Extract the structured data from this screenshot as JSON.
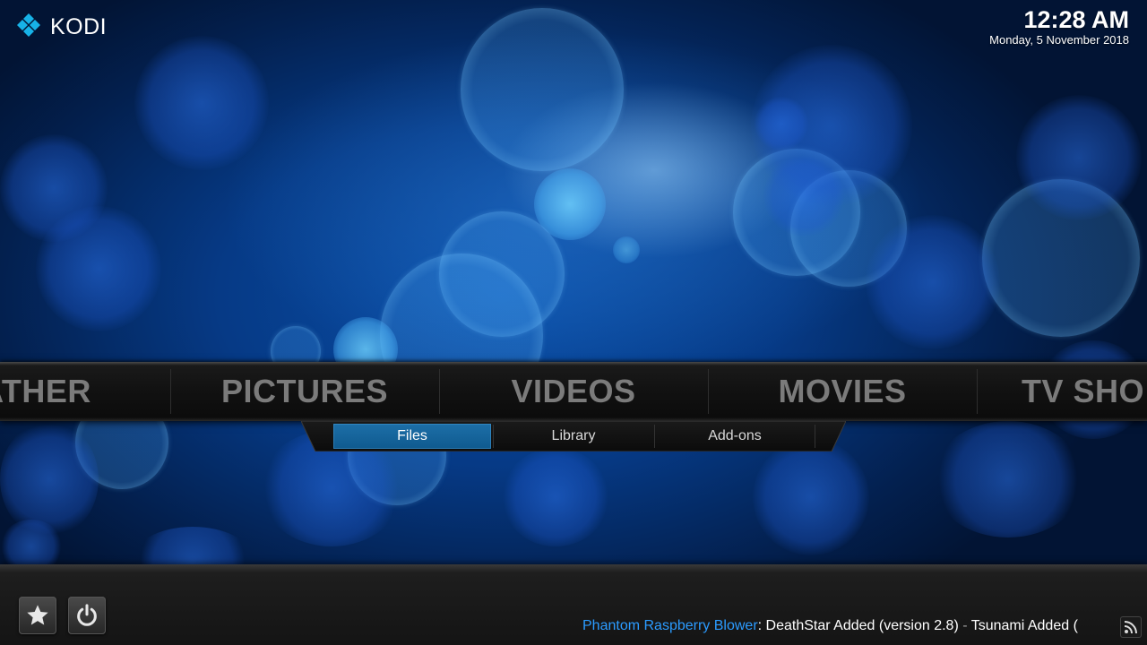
{
  "app": {
    "logo_text": "KODI",
    "brand_color": "#17b2e7"
  },
  "header": {
    "time": "12:28 AM",
    "date": "Monday, 5 November 2018"
  },
  "main_menu": {
    "items": [
      {
        "label": "ATHER",
        "icon": "none"
      },
      {
        "label": "PICTURES"
      },
      {
        "label": "VIDEOS",
        "selected": true
      },
      {
        "label": "MOVIES"
      },
      {
        "label": "TV SHO"
      }
    ]
  },
  "submenu": {
    "items": [
      {
        "label": "Files",
        "active": true
      },
      {
        "label": "Library"
      },
      {
        "label": "Add-ons"
      }
    ],
    "active_color": "#1d6fa8"
  },
  "footer": {
    "favourites_icon": "star-icon",
    "power_icon": "power-icon",
    "rss": {
      "source": "Phantom Raspberry Blower",
      "separator": ":",
      "item1": "DeathStar Added (version 2.8)",
      "dash": " - ",
      "item2": "Tsunami Added (",
      "source_color": "#2b9bff"
    },
    "rss_icon": "rss-feed-icon"
  }
}
